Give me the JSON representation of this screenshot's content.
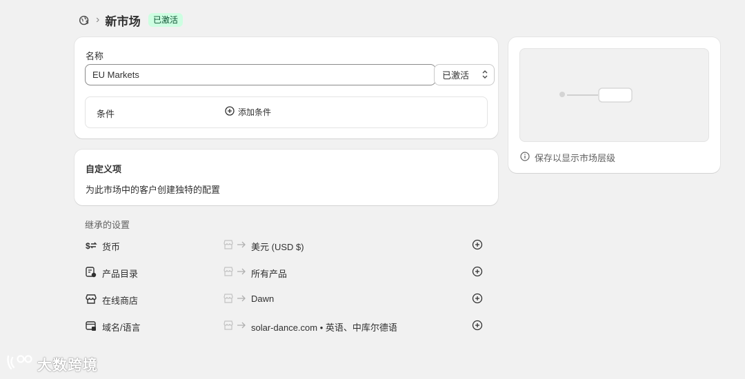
{
  "header": {
    "breadcrumb_icon": "markets-globe-icon",
    "separator": "›",
    "title": "新市场",
    "status_badge": "已激活",
    "badge_color": "#cdfee1"
  },
  "name_card": {
    "name_label": "名称",
    "name_value": "EU Markets",
    "status_value": "已激活",
    "conditions_label": "条件",
    "add_condition_label": "添加条件"
  },
  "custom_card": {
    "title": "自定义项",
    "description": "为此市场中的客户创建独特的配置"
  },
  "preview_card": {
    "info_text": "保存以显示市场层级"
  },
  "inherited": {
    "heading": "继承的设置",
    "rows": [
      {
        "label": "货币",
        "icon": "currency-exchange-icon",
        "value": "美元 (USD $)"
      },
      {
        "label": "产品目录",
        "icon": "catalog-icon",
        "value": "所有产品"
      },
      {
        "label": "在线商店",
        "icon": "online-store-icon",
        "value": "Dawn"
      },
      {
        "label": "域名/语言",
        "icon": "domain-language-icon",
        "value": "solar-dance.com  •  英语、中库尔德语"
      }
    ]
  },
  "watermark": {
    "text": "大数跨境"
  }
}
